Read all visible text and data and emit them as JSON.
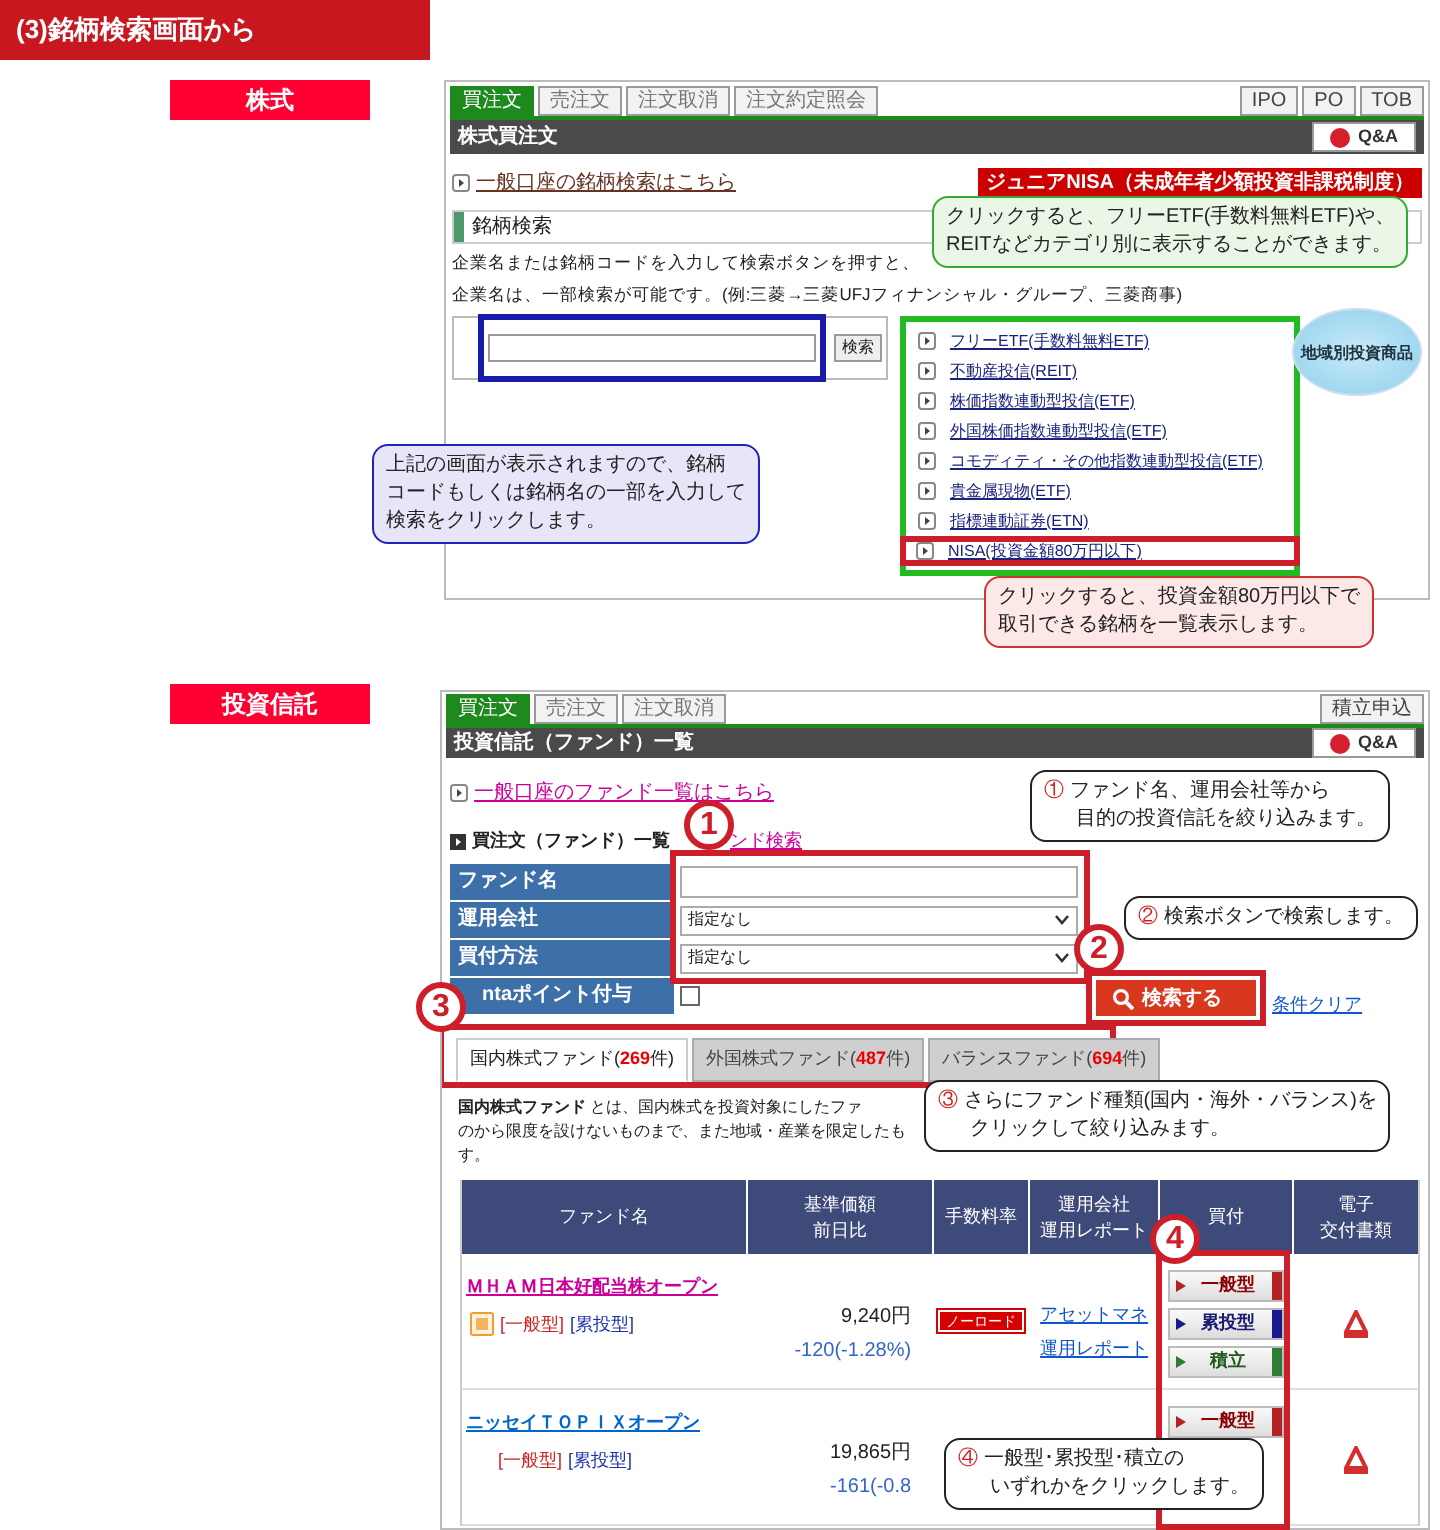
{
  "header": {
    "title": "(3)銘柄検索画面から"
  },
  "stocks": {
    "label": "株式",
    "tabs": [
      {
        "label": "買注文",
        "selected": true
      },
      {
        "label": "売注文",
        "selected": false
      },
      {
        "label": "注文取消",
        "selected": false
      },
      {
        "label": "注文約定照会",
        "selected": false
      }
    ],
    "right_tabs": [
      "IPO",
      "PO",
      "TOB"
    ],
    "title": "株式買注文",
    "qa_button": "Q&A",
    "general_link": "一般口座の銘柄検索はこちら",
    "junior_nisa_badge": "ジュニアNISA（未成年者少額投資非課税制度）",
    "search_heading": "銘柄検索",
    "description": [
      "企業名または銘柄コードを入力して検索ボタンを押すと、",
      "企業名は、一部検索が可能です。(例:三菱→三菱UFJフィナンシャル・グループ、三菱商事)"
    ],
    "search_button": "検索",
    "categories": [
      {
        "label": "フリーETF(手数料無料ETF)",
        "highlighted": false
      },
      {
        "label": "不動産投信(REIT)",
        "highlighted": false
      },
      {
        "label": "株価指数連動型投信(ETF)",
        "highlighted": false
      },
      {
        "label": "外国株価指数連動型投信(ETF)",
        "highlighted": false
      },
      {
        "label": "コモディティ・その他指数連動型投信(ETF)",
        "highlighted": false
      },
      {
        "label": "貴金属現物(ETF)",
        "highlighted": false
      },
      {
        "label": "指標連動証券(ETN)",
        "highlighted": false
      },
      {
        "label": "NISA(投資金額80万円以下)",
        "highlighted": true
      }
    ],
    "region_badge": "地域別投資商品",
    "callouts": [
      {
        "color": "#33aa33",
        "lines": [
          "クリックすると、フリーETF(手数料無料ETF)や、",
          "REITなどカテゴリ別に表示することができます。"
        ]
      },
      {
        "color": "#2222bb",
        "lines": [
          "上記の画面が表示されますので、銘柄",
          "コードもしくは銘柄名の一部を入力して",
          "検索をクリックします。"
        ]
      },
      {
        "color": "#cc3333",
        "lines": [
          "クリックすると、投資金額80万円以下で",
          "取引できる銘柄を一覧表示します。"
        ]
      }
    ]
  },
  "funds": {
    "label": "投資信託",
    "tabs": [
      {
        "label": "買注文",
        "selected": true
      },
      {
        "label": "売注文",
        "selected": false
      },
      {
        "label": "注文取消",
        "selected": false
      }
    ],
    "right_tab": "積立申込",
    "title": "投資信託（ファンド）一覧",
    "qa_button": "Q&A",
    "general_link": "一般口座のファンド一覧はこちら",
    "heading": "買注文（ファンド）一覧",
    "heading_link": "ンド検索",
    "form_rows": [
      {
        "label": "ファンド名",
        "kind": "text"
      },
      {
        "label": "運用会社",
        "kind": "select",
        "value": "指定なし"
      },
      {
        "label": "買付方法",
        "kind": "select",
        "value": "指定なし"
      },
      {
        "label": "ntaポイント付与",
        "kind": "checkbox",
        "checked": false
      }
    ],
    "search_button": "検索する",
    "clear_link": "条件クリア",
    "fund_tabs": [
      {
        "name": "国内株式ファンド(",
        "count": "269",
        "suffix": "件)",
        "selected": true
      },
      {
        "name": "外国株式ファンド(",
        "count": "487",
        "suffix": "件)",
        "selected": false
      },
      {
        "name": "バランスファンド(",
        "count": "694",
        "suffix": "件)",
        "selected": false
      }
    ],
    "description": [
      "**国内株式ファンド** とは、国内株式を投資対象にしたファ",
      "のから限度を設けないものまで、また地域・産業を限定したも",
      "す。"
    ],
    "table": {
      "columns": [
        [
          "ファンド名"
        ],
        [
          "基準価額",
          "前日比"
        ],
        [
          "手数料率"
        ],
        [
          "運用会社",
          "運用レポート"
        ],
        [
          "買付"
        ],
        [
          "電子",
          "交付書類"
        ]
      ],
      "rows": [
        {
          "name": "ＭＨＡＭ日本好配当株オープン",
          "color": "#cc0099",
          "point_icon": true,
          "types": [
            {
              "label": "[一般型]",
              "kind": "general"
            },
            {
              "label": "[累投型]",
              "kind": "cumulative"
            }
          ],
          "price": "9,240円",
          "change": "-120(-1.28%)",
          "fee": "ノーロード",
          "company": "アセットマネ",
          "report": "運用レポート",
          "buy_buttons": [
            {
              "label": "一般型",
              "kind": "general"
            },
            {
              "label": "累投型",
              "kind": "cumulative"
            },
            {
              "label": "積立",
              "kind": "installment"
            }
          ]
        },
        {
          "name": "ニッセイＴＯＰＩＸオープン",
          "color": "#0066cc",
          "point_icon": false,
          "types": [
            {
              "label": "[一般型]",
              "kind": "general"
            },
            {
              "label": "[累投型]",
              "kind": "cumulative"
            }
          ],
          "price": "19,865円",
          "change": "-161(-0.8",
          "buy_buttons": [
            {
              "label": "一般型",
              "kind": "general"
            }
          ]
        }
      ]
    },
    "steps": [
      "1",
      "2",
      "3",
      "4"
    ],
    "callouts": [
      {
        "number": "①",
        "lines": [
          "ファンド名、運用会社等から",
          "目的の投資信託を絞り込みます。"
        ]
      },
      {
        "number": "②",
        "lines": [
          "検索ボタンで検索します。"
        ]
      },
      {
        "number": "③",
        "lines": [
          "さらにファンド種類(国内・海外・バランス)を",
          "クリックして絞り込みます。"
        ]
      },
      {
        "number": "④",
        "lines": [
          "一般型･累投型･積立の",
          "いずれかをクリックします。"
        ]
      }
    ]
  }
}
